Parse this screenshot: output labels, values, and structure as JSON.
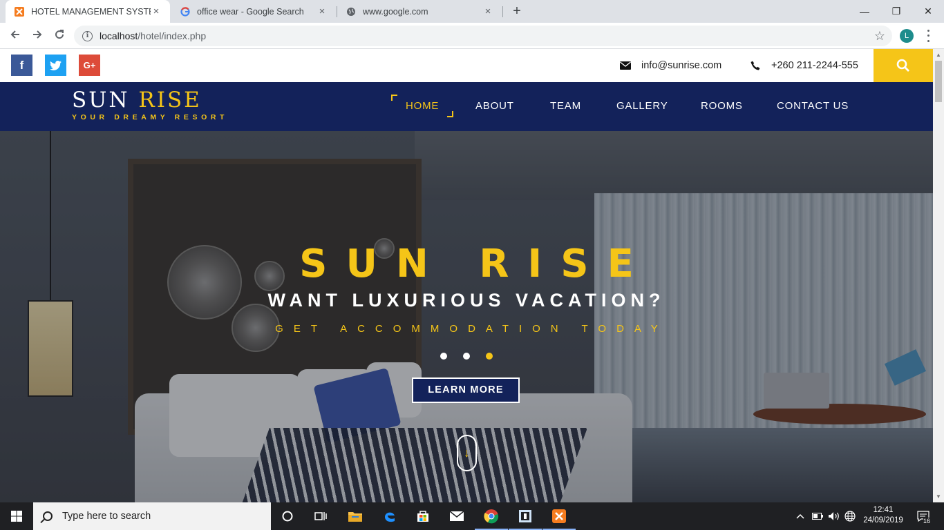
{
  "browser": {
    "tabs": [
      {
        "title": "HOTEL MANAGEMENT SYSTEM",
        "active": true
      },
      {
        "title": "office wear - Google Search",
        "active": false
      },
      {
        "title": "www.google.com",
        "active": false
      }
    ],
    "close_glyph": "×",
    "new_tab_glyph": "+",
    "url_host": "localhost",
    "url_path": "/hotel/index.php",
    "profile_initial": "L",
    "window_controls": {
      "minimize": "—",
      "restore": "❐",
      "close": "✕"
    }
  },
  "site": {
    "social": {
      "facebook": "f",
      "twitter": "t",
      "google_plus": "G+"
    },
    "email": "info@sunrise.com",
    "phone": "+260 211-2244-555",
    "brand": {
      "name_main": "SUN",
      "name_accent": "RISE",
      "tagline": "YOUR DREAMY RESORT"
    },
    "nav": {
      "home": "HOME",
      "about": "ABOUT",
      "team": "TEAM",
      "gallery": "GALLERY",
      "rooms": "ROOMS",
      "contact": "CONTACT US"
    },
    "hero": {
      "title": "SUN RISE",
      "subtitle": "WANT LUXURIOUS VACATION?",
      "tagline": "GET ACCOMMODATION TODAY",
      "slide_count": 3,
      "active_slide": 3,
      "button": "LEARN MORE",
      "scroll_glyph": "↓"
    },
    "colors": {
      "accent": "#f5c518",
      "navy": "#13225a"
    }
  },
  "taskbar": {
    "search_placeholder": "Type here to search",
    "time": "12:41",
    "date": "24/09/2019",
    "notification_count": "16"
  }
}
